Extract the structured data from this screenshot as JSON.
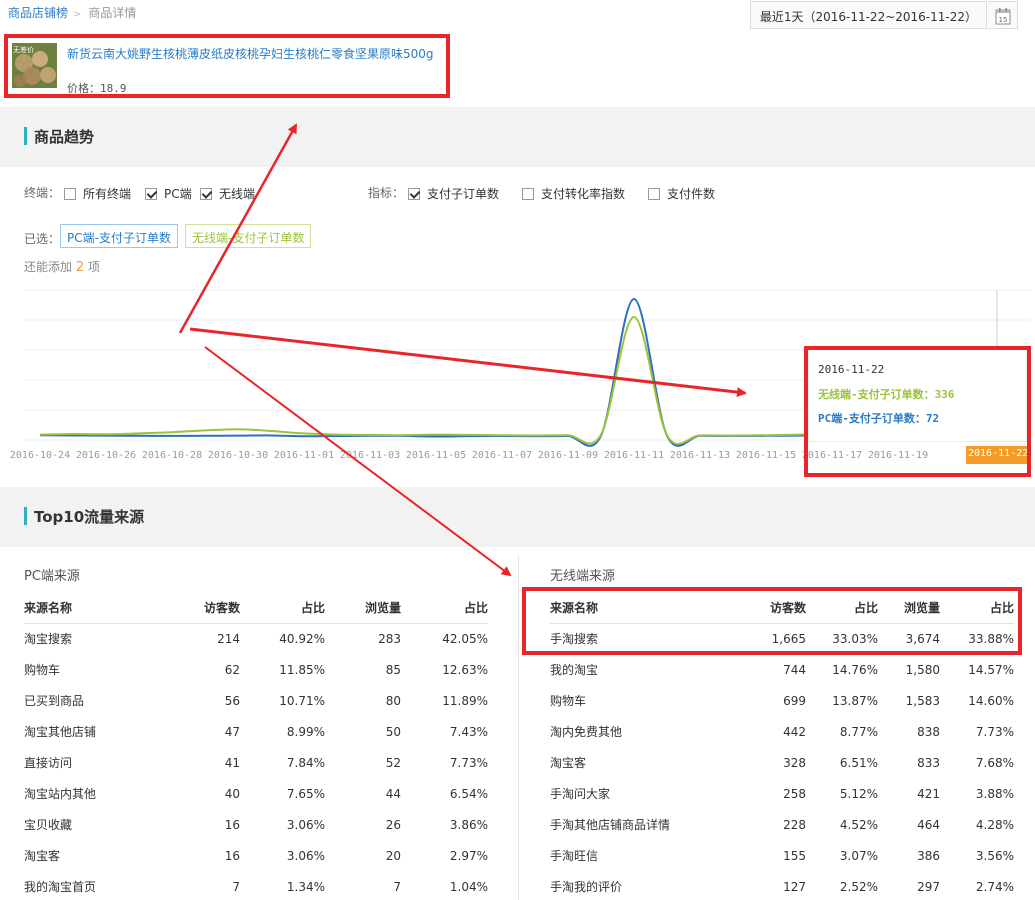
{
  "breadcrumb": {
    "parent": "商品店铺榜",
    "current": "商品详情"
  },
  "date_range": "最近1天（2016-11-22~2016-11-22）",
  "calendar_day": "15",
  "product": {
    "title": "新货云南大姚野生核桃薄皮纸皮核桃孕妇生核桃仁零食坚果原味500g",
    "price_label": "价格：18.9",
    "image_badge": "无差价"
  },
  "trend": {
    "title": "商品趋势",
    "terminal_label": "终端：",
    "terminals": [
      {
        "label": "所有终端",
        "checked": false
      },
      {
        "label": "PC端",
        "checked": true
      },
      {
        "label": "无线端",
        "checked": true
      }
    ],
    "metric_label": "指标：",
    "metrics": [
      {
        "label": "支付子订单数",
        "checked": true
      },
      {
        "label": "支付转化率指数",
        "checked": false
      },
      {
        "label": "支付件数",
        "checked": false
      }
    ],
    "selected_label": "已选：",
    "chips": [
      "PC端-支付子订单数",
      "无线端-支付子订单数"
    ],
    "add_prefix": "还能添加",
    "add_count": "2",
    "add_suffix": "项"
  },
  "chart_data": {
    "type": "line",
    "x": [
      "2016-10-24",
      "2016-10-25",
      "2016-10-26",
      "2016-10-27",
      "2016-10-28",
      "2016-10-29",
      "2016-10-30",
      "2016-10-31",
      "2016-11-01",
      "2016-11-02",
      "2016-11-03",
      "2016-11-04",
      "2016-11-05",
      "2016-11-06",
      "2016-11-07",
      "2016-11-08",
      "2016-11-09",
      "2016-11-10",
      "2016-11-11",
      "2016-11-12",
      "2016-11-13",
      "2016-11-14",
      "2016-11-15",
      "2016-11-16",
      "2016-11-17",
      "2016-11-18",
      "2016-11-19",
      "2016-11-20",
      "2016-11-21",
      "2016-11-22"
    ],
    "x_tick_labels": [
      "2016-10-24",
      "2016-10-26",
      "2016-10-28",
      "2016-10-30",
      "2016-11-01",
      "2016-11-03",
      "2016-11-05",
      "2016-11-07",
      "2016-11-09",
      "2016-11-11",
      "2016-11-13",
      "2016-11-15",
      "2016-11-17",
      "2016-11-19",
      "2016-11-22"
    ],
    "series": [
      {
        "name": "PC端-支付子订单数",
        "color": "#2b6ec4",
        "values": [
          80,
          76,
          72,
          70,
          68,
          70,
          72,
          76,
          62,
          66,
          70,
          68,
          58,
          64,
          66,
          62,
          66,
          72,
          2350,
          72,
          70,
          68,
          70,
          72,
          74,
          76,
          74,
          72,
          74,
          72
        ]
      },
      {
        "name": "无线端-支付子订单数",
        "color": "#9cc23a",
        "values": [
          90,
          100,
          95,
          110,
          130,
          160,
          180,
          150,
          110,
          90,
          85,
          80,
          90,
          85,
          80,
          75,
          80,
          90,
          2050,
          80,
          78,
          76,
          80,
          90,
          100,
          120,
          150,
          250,
          320,
          336
        ]
      }
    ],
    "ylim": [
      0,
      2500
    ],
    "grid": true,
    "tooltip": {
      "date": "2016-11-22",
      "mobile": "无线端-支付子订单数：336",
      "pc": "PC端-支付子订单数：72"
    }
  },
  "top10": {
    "title": "Top10流量来源",
    "pc": {
      "caption": "PC端来源",
      "headers": [
        "来源名称",
        "访客数",
        "占比",
        "浏览量",
        "占比"
      ],
      "rows": [
        [
          "淘宝搜索",
          "214",
          "40.92%",
          "283",
          "42.05%"
        ],
        [
          "购物车",
          "62",
          "11.85%",
          "85",
          "12.63%"
        ],
        [
          "已买到商品",
          "56",
          "10.71%",
          "80",
          "11.89%"
        ],
        [
          "淘宝其他店铺",
          "47",
          "8.99%",
          "50",
          "7.43%"
        ],
        [
          "直接访问",
          "41",
          "7.84%",
          "52",
          "7.73%"
        ],
        [
          "淘宝站内其他",
          "40",
          "7.65%",
          "44",
          "6.54%"
        ],
        [
          "宝贝收藏",
          "16",
          "3.06%",
          "26",
          "3.86%"
        ],
        [
          "淘宝客",
          "16",
          "3.06%",
          "20",
          "2.97%"
        ],
        [
          "我的淘宝首页",
          "7",
          "1.34%",
          "7",
          "1.04%"
        ]
      ]
    },
    "mobile": {
      "caption": "无线端来源",
      "headers": [
        "来源名称",
        "访客数",
        "占比",
        "浏览量",
        "占比"
      ],
      "rows": [
        [
          "手淘搜索",
          "1,665",
          "33.03%",
          "3,674",
          "33.88%"
        ],
        [
          "我的淘宝",
          "744",
          "14.76%",
          "1,580",
          "14.57%"
        ],
        [
          "购物车",
          "699",
          "13.87%",
          "1,583",
          "14.60%"
        ],
        [
          "淘内免费其他",
          "442",
          "8.77%",
          "838",
          "7.73%"
        ],
        [
          "淘宝客",
          "328",
          "6.51%",
          "833",
          "7.68%"
        ],
        [
          "手淘问大家",
          "258",
          "5.12%",
          "421",
          "3.88%"
        ],
        [
          "手淘其他店铺商品详情",
          "228",
          "4.52%",
          "464",
          "4.28%"
        ],
        [
          "手淘旺信",
          "155",
          "3.07%",
          "386",
          "3.56%"
        ],
        [
          "手淘我的评价",
          "127",
          "2.52%",
          "297",
          "2.74%"
        ]
      ]
    }
  },
  "colors": {
    "accent": "#2b7cc4",
    "highlight": "#e8262a",
    "mobile": "#9cc23a",
    "orange": "#f39c2c"
  }
}
